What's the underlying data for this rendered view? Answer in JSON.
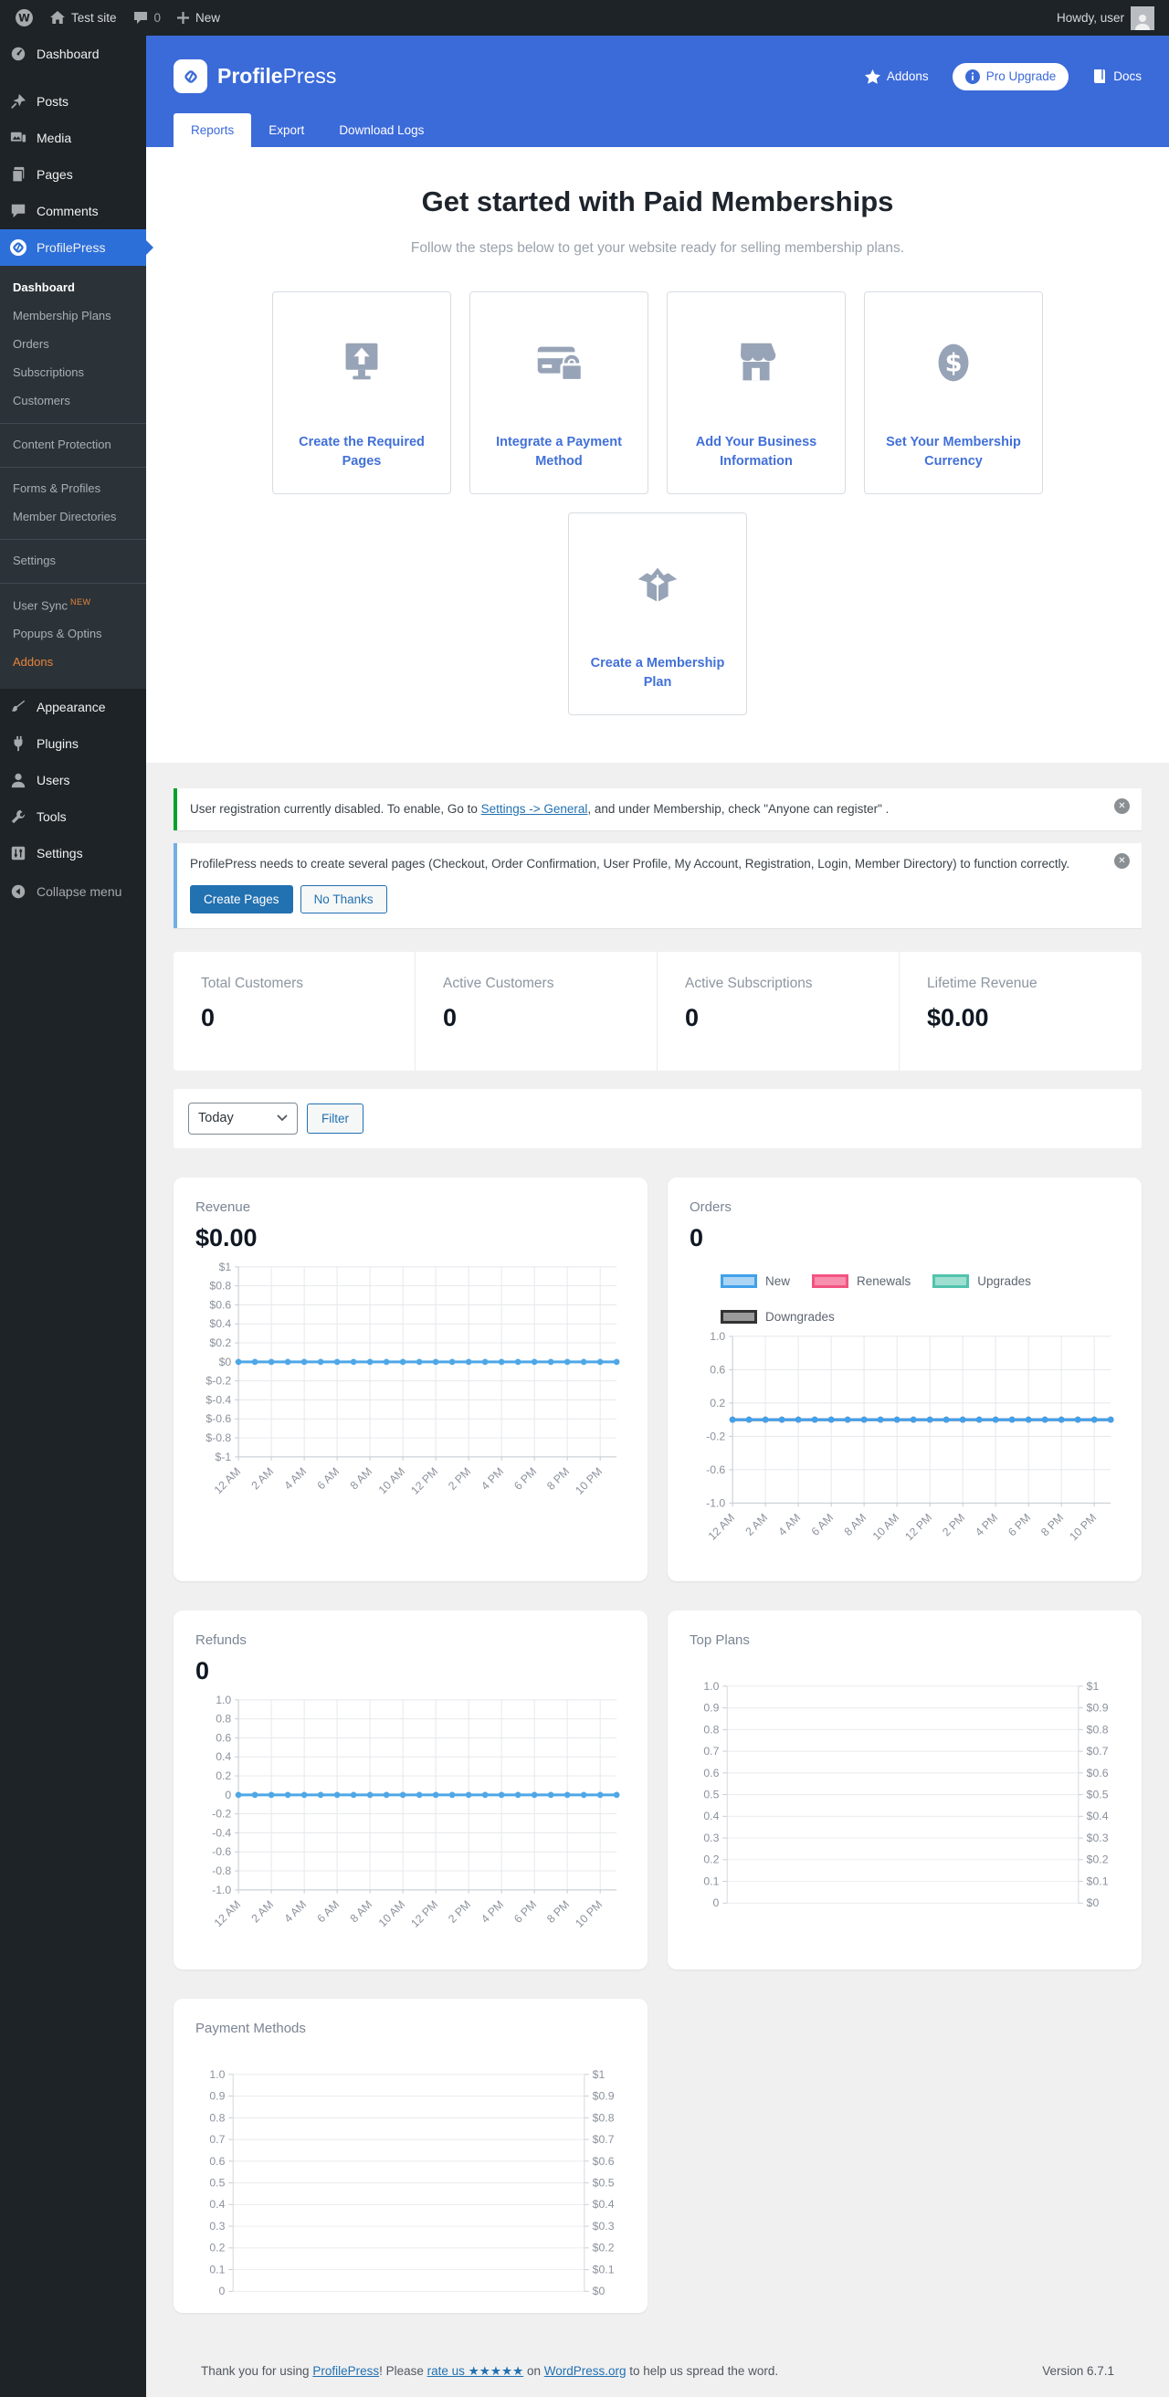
{
  "admin_bar": {
    "site_name": "Test site",
    "comments_count": "0",
    "new_label": "New",
    "howdy": "Howdy, user"
  },
  "sidebar": {
    "items": [
      {
        "label": "Dashboard"
      },
      {
        "label": "Posts"
      },
      {
        "label": "Media"
      },
      {
        "label": "Pages"
      },
      {
        "label": "Comments"
      },
      {
        "label": "ProfilePress"
      },
      {
        "label": "Appearance"
      },
      {
        "label": "Plugins"
      },
      {
        "label": "Users"
      },
      {
        "label": "Tools"
      },
      {
        "label": "Settings"
      },
      {
        "label": "Collapse menu"
      }
    ],
    "submenu": [
      {
        "label": "Dashboard"
      },
      {
        "label": "Membership Plans"
      },
      {
        "label": "Orders"
      },
      {
        "label": "Subscriptions"
      },
      {
        "label": "Customers"
      },
      {
        "label": "Content Protection"
      },
      {
        "label": "Forms & Profiles"
      },
      {
        "label": "Member Directories"
      },
      {
        "label": "Settings"
      },
      {
        "label": "User Sync",
        "badge": "NEW"
      },
      {
        "label": "Popups & Optins"
      },
      {
        "label": "Addons"
      }
    ]
  },
  "header": {
    "brand_bold": "Profile",
    "brand_light": "Press",
    "nav": {
      "addons": "Addons",
      "pro_upgrade": "Pro Upgrade",
      "docs": "Docs"
    },
    "tabs": [
      {
        "label": "Reports",
        "active": true
      },
      {
        "label": "Export"
      },
      {
        "label": "Download Logs"
      }
    ]
  },
  "onboarding": {
    "title": "Get started with Paid Memberships",
    "subtitle": "Follow the steps below to get your website ready for selling membership plans.",
    "steps": [
      {
        "label": "Create the Required Pages"
      },
      {
        "label": "Integrate a Payment Method"
      },
      {
        "label": "Add Your Business Information"
      },
      {
        "label": "Set Your Membership Currency"
      },
      {
        "label": "Create a Membership Plan"
      }
    ]
  },
  "notices": [
    {
      "prefix": "User registration currently disabled. To enable, Go to ",
      "link": "Settings -> General",
      "suffix": ", and under Membership, check \"Anyone can register\" ."
    },
    {
      "text": "ProfilePress needs to create several pages (Checkout, Order Confirmation, User Profile, My Account, Registration, Login, Member Directory) to function correctly.",
      "primary_button": "Create Pages",
      "secondary_button": "No Thanks"
    }
  ],
  "stats": [
    {
      "label": "Total Customers",
      "value": "0"
    },
    {
      "label": "Active Customers",
      "value": "0"
    },
    {
      "label": "Active Subscriptions",
      "value": "0"
    },
    {
      "label": "Lifetime Revenue",
      "value": "$0.00"
    }
  ],
  "filter": {
    "selected": "Today",
    "button": "Filter"
  },
  "chart_data": [
    {
      "type": "line",
      "title": "Revenue",
      "value": "$0.00",
      "y_ticks": [
        "$1",
        "$0.8",
        "$0.6",
        "$0.4",
        "$0.2",
        "$0",
        "$-0.2",
        "$-0.4",
        "$-0.6",
        "$-0.8",
        "$-1"
      ],
      "ylim": [
        -1,
        1
      ],
      "categories": [
        "12 AM",
        "2 AM",
        "4 AM",
        "6 AM",
        "8 AM",
        "10 AM",
        "12 PM",
        "2 PM",
        "4 PM",
        "6 PM",
        "8 PM",
        "10 PM"
      ],
      "series": [
        {
          "name": "Revenue",
          "values": [
            0,
            0,
            0,
            0,
            0,
            0,
            0,
            0,
            0,
            0,
            0,
            0,
            0,
            0,
            0,
            0,
            0,
            0,
            0,
            0,
            0,
            0,
            0,
            0
          ]
        }
      ],
      "line_color": "#4fa7e6",
      "grid": true,
      "legend_position": "none"
    },
    {
      "type": "line",
      "title": "Orders",
      "value": "0",
      "y_ticks": [
        "1.0",
        "0.6",
        "0.2",
        "-0.2",
        "-0.6",
        "-1.0"
      ],
      "ylim": [
        -1,
        1
      ],
      "categories": [
        "12 AM",
        "2 AM",
        "4 AM",
        "6 AM",
        "8 AM",
        "10 AM",
        "12 PM",
        "2 PM",
        "4 PM",
        "6 PM",
        "8 PM",
        "10 PM"
      ],
      "series": [
        {
          "name": "New",
          "values": [
            0,
            0,
            0,
            0,
            0,
            0,
            0,
            0,
            0,
            0,
            0,
            0,
            0,
            0,
            0,
            0,
            0,
            0,
            0,
            0,
            0,
            0,
            0,
            0
          ],
          "fill": "#abd4f5",
          "border": "#41a1ea"
        },
        {
          "name": "Renewals",
          "values": [
            0,
            0,
            0,
            0,
            0,
            0,
            0,
            0,
            0,
            0,
            0,
            0,
            0,
            0,
            0,
            0,
            0,
            0,
            0,
            0,
            0,
            0,
            0,
            0
          ],
          "fill": "#f78fae",
          "border": "#f25480"
        },
        {
          "name": "Upgrades",
          "values": [
            0,
            0,
            0,
            0,
            0,
            0,
            0,
            0,
            0,
            0,
            0,
            0,
            0,
            0,
            0,
            0,
            0,
            0,
            0,
            0,
            0,
            0,
            0,
            0
          ],
          "fill": "#9fdfd1",
          "border": "#52c3ad"
        },
        {
          "name": "Downgrades",
          "values": [
            0,
            0,
            0,
            0,
            0,
            0,
            0,
            0,
            0,
            0,
            0,
            0,
            0,
            0,
            0,
            0,
            0,
            0,
            0,
            0,
            0,
            0,
            0,
            0
          ],
          "fill": "#9a9a9a",
          "border": "#333333"
        }
      ],
      "line_color": "#4fa7e6",
      "grid": true,
      "legend_position": "top"
    },
    {
      "type": "line",
      "title": "Refunds",
      "value": "0",
      "y_ticks": [
        "1.0",
        "0.8",
        "0.6",
        "0.4",
        "0.2",
        "0",
        "-0.2",
        "-0.4",
        "-0.6",
        "-0.8",
        "-1.0"
      ],
      "ylim": [
        -1,
        1
      ],
      "categories": [
        "12 AM",
        "2 AM",
        "4 AM",
        "6 AM",
        "8 AM",
        "10 AM",
        "12 PM",
        "2 PM",
        "4 PM",
        "6 PM",
        "8 PM",
        "10 PM"
      ],
      "series": [
        {
          "name": "Refunds",
          "values": [
            0,
            0,
            0,
            0,
            0,
            0,
            0,
            0,
            0,
            0,
            0,
            0,
            0,
            0,
            0,
            0,
            0,
            0,
            0,
            0,
            0,
            0,
            0,
            0
          ]
        }
      ],
      "line_color": "#4fa7e6",
      "grid": true,
      "legend_position": "none"
    },
    {
      "type": "dual_axis_empty",
      "title": "Top Plans",
      "left_ticks": [
        "1.0",
        "0.9",
        "0.8",
        "0.7",
        "0.6",
        "0.5",
        "0.4",
        "0.3",
        "0.2",
        "0.1",
        "0"
      ],
      "right_ticks": [
        "$1",
        "$0.9",
        "$0.8",
        "$0.7",
        "$0.6",
        "$0.5",
        "$0.4",
        "$0.3",
        "$0.2",
        "$0.1",
        "$0"
      ],
      "grid": true
    },
    {
      "type": "dual_axis_empty",
      "title": "Payment Methods",
      "left_ticks": [
        "1.0",
        "0.9",
        "0.8",
        "0.7",
        "0.6",
        "0.5",
        "0.4",
        "0.3",
        "0.2",
        "0.1",
        "0"
      ],
      "right_ticks": [
        "$1",
        "$0.9",
        "$0.8",
        "$0.7",
        "$0.6",
        "$0.5",
        "$0.4",
        "$0.3",
        "$0.2",
        "$0.1",
        "$0"
      ],
      "grid": true
    }
  ],
  "footer": {
    "part1": "Thank you for using ",
    "link1": "ProfilePress",
    "part2": "! Please ",
    "link2": "rate us ★★★★★",
    "part3": " on ",
    "link3": "WordPress.org",
    "part4": " to help us spread the word.",
    "version": "Version 6.7.1"
  },
  "colors": {
    "header_blue": "#3b6ad9",
    "sidebar_active_blue": "#2d6fd9",
    "wp_link_blue": "#2271b1",
    "notice_green": "#00a32a",
    "notice_blue": "#72aee6",
    "chart_line_blue": "#4fa7e6",
    "step_label_blue": "#4170d8"
  }
}
